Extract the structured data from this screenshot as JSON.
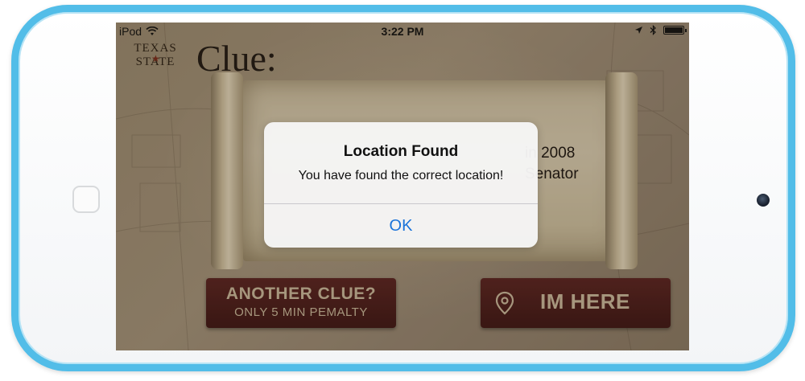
{
  "status_bar": {
    "carrier": "iPod",
    "time": "3:22 PM"
  },
  "logo": {
    "line1": "TEXAS",
    "line2": "STATE"
  },
  "page_title": "Clue:",
  "clue_text": {
    "line1": "in 2008",
    "line2": "Senator"
  },
  "buttons": {
    "another_clue": "ANOTHER CLUE?",
    "another_clue_sub": "ONLY 5 MIN PEMALTY",
    "im_here": "IM HERE"
  },
  "alert": {
    "title": "Location Found",
    "message": "You have found the correct location!",
    "ok_label": "OK"
  },
  "colors": {
    "device_frame": "#52bde8",
    "button_bg": "#4a1a18",
    "alert_action": "#1a73d9"
  }
}
